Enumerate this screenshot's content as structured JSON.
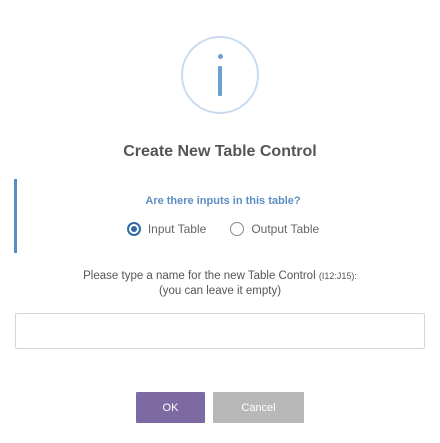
{
  "dialog": {
    "title": "Create New Table Control",
    "question": "Are there inputs in this table?",
    "options": [
      {
        "label": "Input Table",
        "selected": true
      },
      {
        "label": "Output Table",
        "selected": false
      }
    ],
    "prompt_line1": "Please type a name for the new Table Control",
    "prompt_range": "(I12:J15):",
    "prompt_line2": "(you can leave it empty)",
    "name_value": "",
    "ok_label": "OK",
    "cancel_label": "Cancel"
  },
  "colors": {
    "accent_blue": "#5b8ec4",
    "ok_button": "#7e6aa3",
    "cancel_button": "#b8b8b8"
  },
  "icons": {
    "header": "info-icon"
  }
}
